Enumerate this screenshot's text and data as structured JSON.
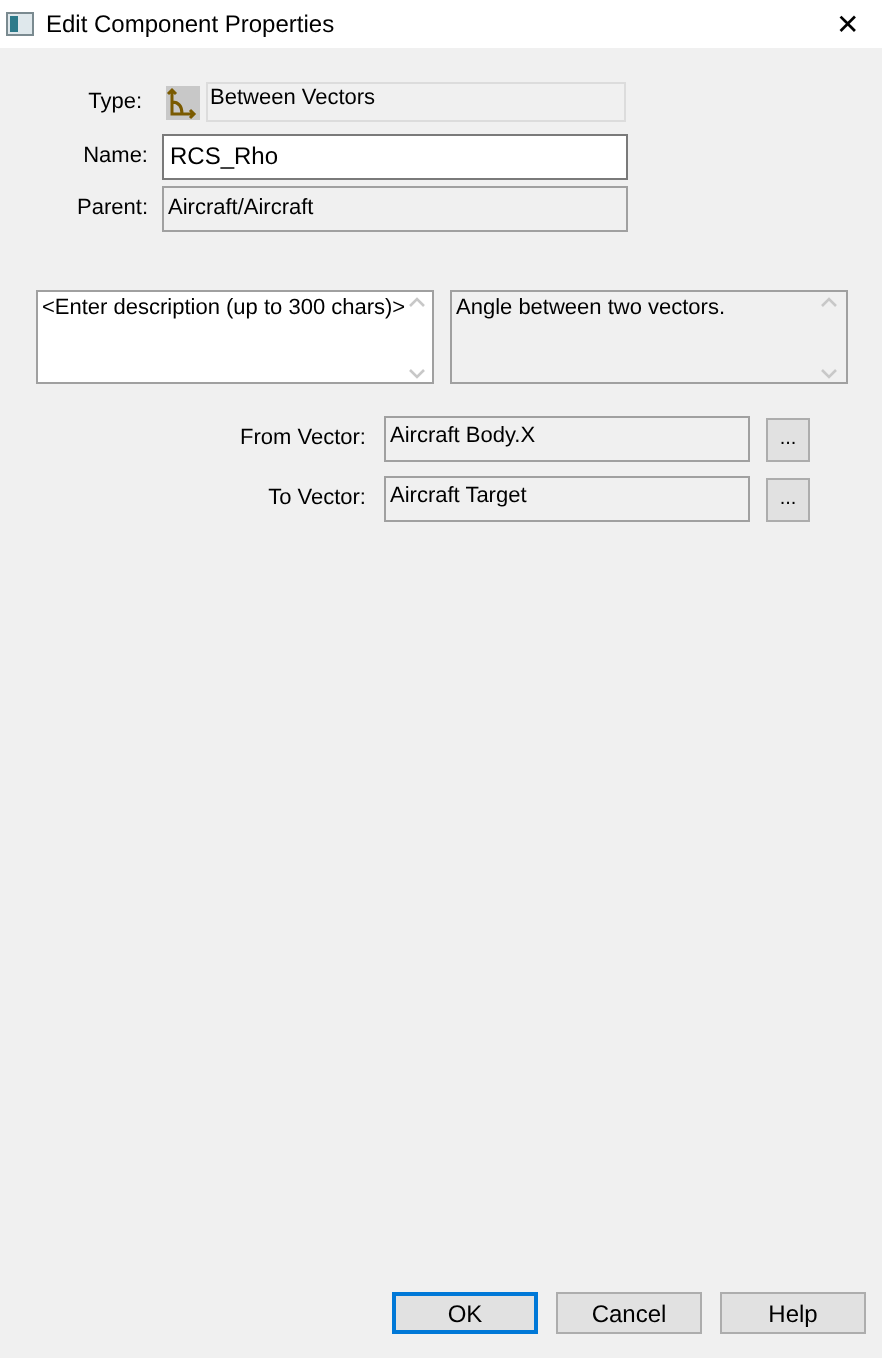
{
  "window": {
    "title": "Edit Component Properties",
    "close": "✕"
  },
  "type": {
    "label": "Type:",
    "value": "Between Vectors"
  },
  "name": {
    "label": "Name:",
    "value": "RCS_Rho"
  },
  "parent": {
    "label": "Parent:",
    "value": "Aircraft/Aircraft"
  },
  "description": {
    "value": "<Enter description (up to 300 chars)>",
    "editable": true
  },
  "info": {
    "value": "Angle between two vectors.",
    "editable": false
  },
  "vectors": [
    {
      "label": "From Vector:",
      "value": "Aircraft Body.X",
      "browse": "..."
    },
    {
      "label": "To Vector:",
      "value": "Aircraft Target",
      "browse": "..."
    }
  ],
  "buttons": [
    {
      "label": "OK",
      "default": true
    },
    {
      "label": "Cancel",
      "default": false
    },
    {
      "label": "Help",
      "default": false
    }
  ]
}
